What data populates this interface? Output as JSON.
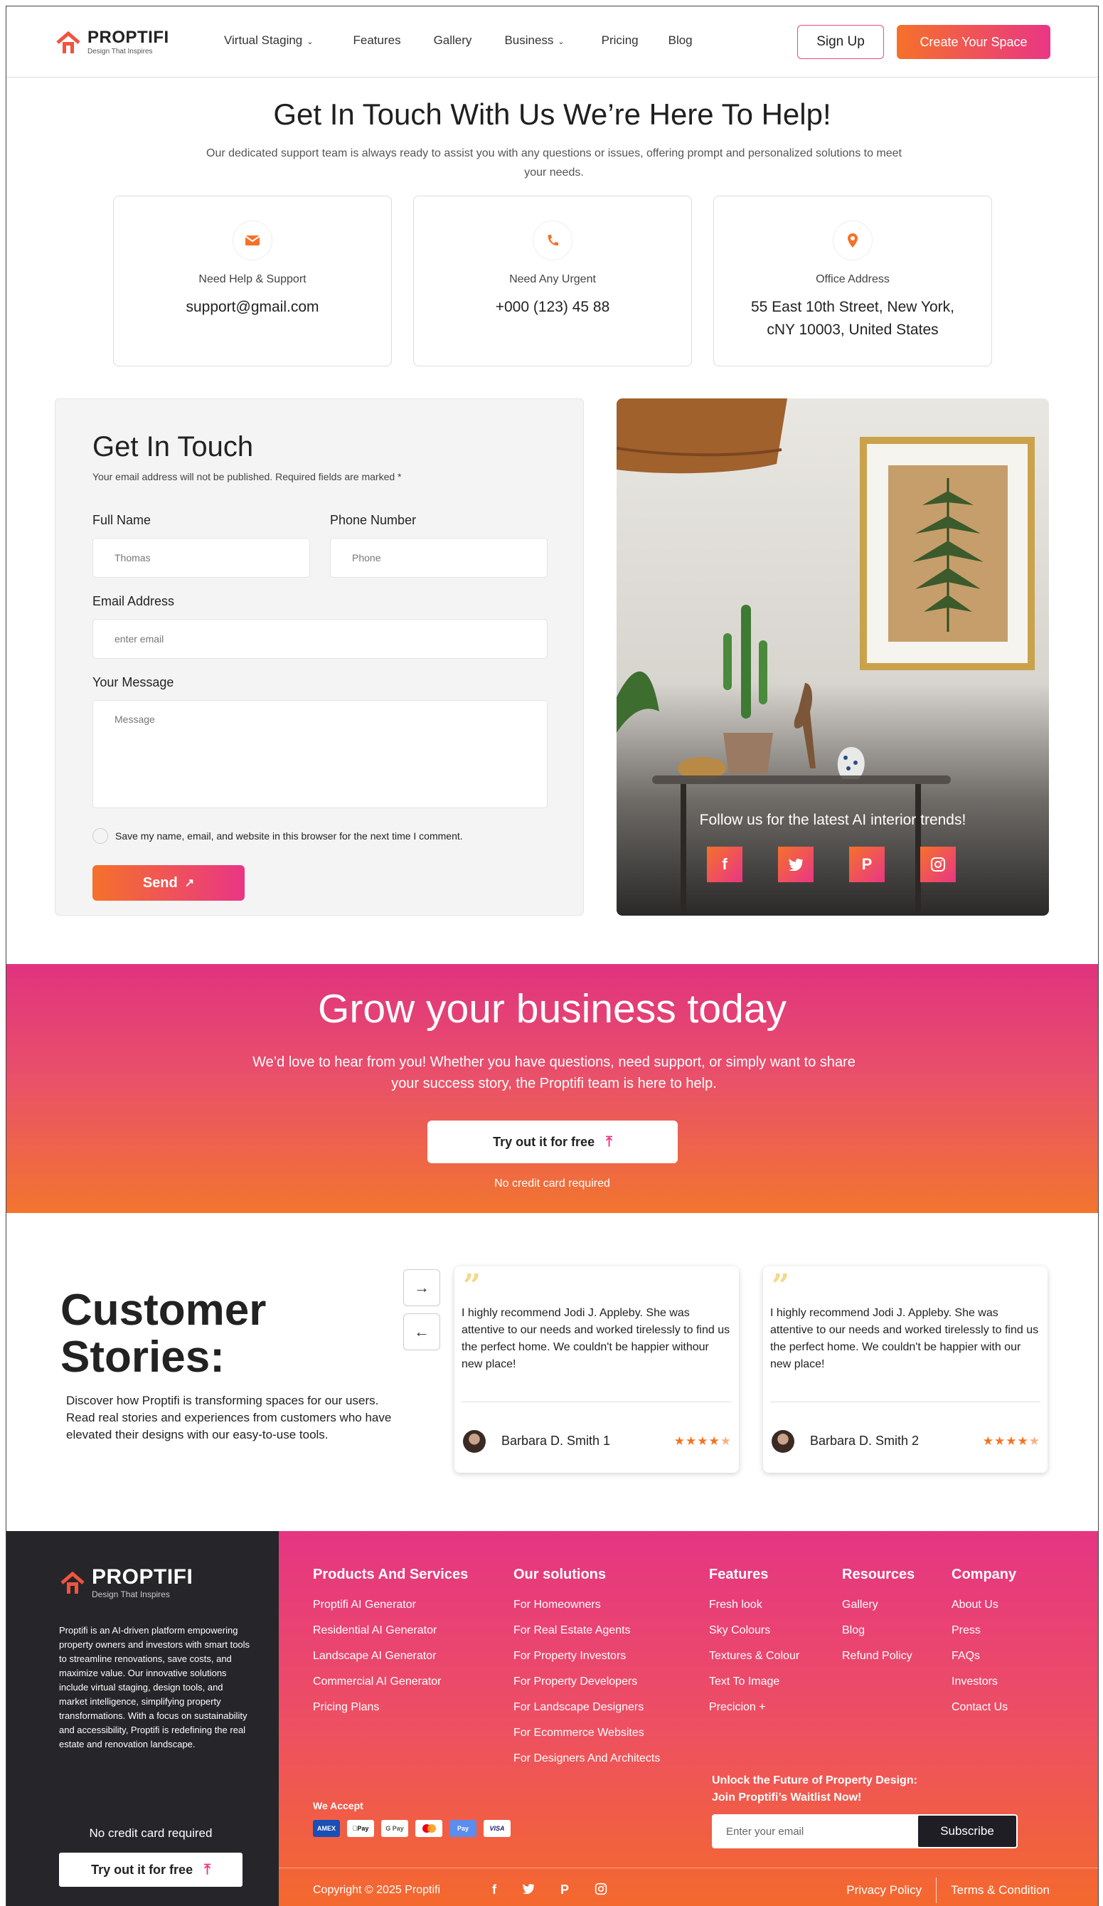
{
  "nav": {
    "brand": "PROPTIFI",
    "tagline": "Design That Inspires",
    "links": [
      "Virtual Staging",
      "Features",
      "Gallery",
      "Business",
      "Pricing",
      "Blog"
    ],
    "sign_up": "Sign Up",
    "create": "Create Your Space"
  },
  "hero": {
    "title": "Get In Touch With Us We’re Here To Help!",
    "subtitle": "Our dedicated support team is always ready to assist you with any questions or issues, offering prompt and personalized solutions to meet your needs."
  },
  "contact_cards": [
    {
      "icon": "envelope-icon",
      "label": "Need Help & Support",
      "value": "support@gmail.com"
    },
    {
      "icon": "phone-icon",
      "label": "Need Any Urgent",
      "value": "+000 (123) 45 88"
    },
    {
      "icon": "location-pin-icon",
      "label": "Office Address",
      "value": "55 East 10th Street, New York, cNY 10003, United States"
    }
  ],
  "form": {
    "title": "Get In Touch",
    "note": "Your email address will not be published. Required fields are marked *",
    "full_name_label": "Full Name",
    "full_name_placeholder": "Thomas",
    "phone_label": "Phone Number",
    "phone_placeholder": "Phone",
    "email_label": "Email Address",
    "email_placeholder": "enter email",
    "message_label": "Your Message",
    "message_placeholder": "Message",
    "save_label": "Save my name, email, and website in this browser for the next time I comment.",
    "send": "Send"
  },
  "photo_panel": {
    "follow": "Follow us for the latest AI interior trends!",
    "socials": [
      "f",
      "t",
      "p",
      "ig"
    ]
  },
  "grow": {
    "title": "Grow your business today",
    "subtitle": "We’d love to hear from you! Whether you have questions, need support, or simply want to share your success story, the Proptifi team is here to help.",
    "cta": "Try out it for free",
    "note": "No credit card required"
  },
  "stories": {
    "title": "Customer Stories:",
    "description": "Discover how Proptifi is transforming spaces for our users. Read real stories and experiences from customers who have elevated their designs with our easy-to-use tools.",
    "reviews": [
      {
        "text": "I highly recommend Jodi J. Appleby. She was attentive to our needs and worked tirelessly to find us the perfect home. We couldn't be happier withour new place!",
        "name": "Barbara D. Smith 1",
        "rating": 4.5
      },
      {
        "text": "I highly recommend Jodi J. Appleby. She was attentive to our needs and worked tirelessly to find us the perfect home. We couldn't be happier with our new place!",
        "name": "Barbara D. Smith 2",
        "rating": 4.5
      }
    ]
  },
  "footer": {
    "brand": "PROPTIFI",
    "tagline": "Design That Inspires",
    "about": "Proptifi is an AI-driven platform empowering property owners and investors with smart tools to streamline renovations, save costs, and maximize value. Our innovative solutions include virtual staging, design tools, and market intelligence, simplifying property transformations. With a focus on sustainability and accessibility, Proptifi is redefining the real estate and renovation landscape.",
    "no_cc": "No credit card required",
    "try": "Try out it for free",
    "columns": [
      {
        "title": "Products And Services",
        "items": [
          "Proptifi AI Generator",
          "Residential AI Generator",
          "Landscape AI Generator",
          "Commercial AI Generator",
          "Pricing Plans"
        ]
      },
      {
        "title": "Our solutions",
        "items": [
          "For Homeowners",
          "For Real Estate Agents",
          "For Property Investors",
          "For Property Developers",
          "For Landscape Designers",
          "For Ecommerce Websites",
          "For Designers And Architects"
        ]
      },
      {
        "title": "Features",
        "items": [
          "Fresh look",
          "Sky Colours",
          "Textures & Colour",
          "Text To Image",
          "Precicion +"
        ]
      },
      {
        "title": "Resources",
        "items": [
          "Gallery",
          "Blog",
          "Refund Policy"
        ]
      },
      {
        "title": "Company",
        "items": [
          "About Us",
          "Press",
          "FAQs",
          "Investors",
          "Contact Us"
        ]
      }
    ],
    "we_accept": "We Accept",
    "payments": [
      "AMEX",
      "Pay",
      "G Pay",
      "MC",
      "Pay",
      "VISA"
    ],
    "unlock_line1": "Unlock the Future of Property Design:",
    "unlock_line2": "Join Proptifi’s Waitlist Now!",
    "email_placeholder": "Enter your email",
    "subscribe": "Subscribe",
    "copyright": "Copyright © 2025 Proptifi",
    "socials": [
      "f",
      "t",
      "p",
      "ig"
    ],
    "privacy": "Privacy Policy",
    "terms": "Terms & Condition"
  },
  "colors": {
    "accent_orange": "#f5712a",
    "accent_pink": "#e93685",
    "dark": "#25252a"
  }
}
